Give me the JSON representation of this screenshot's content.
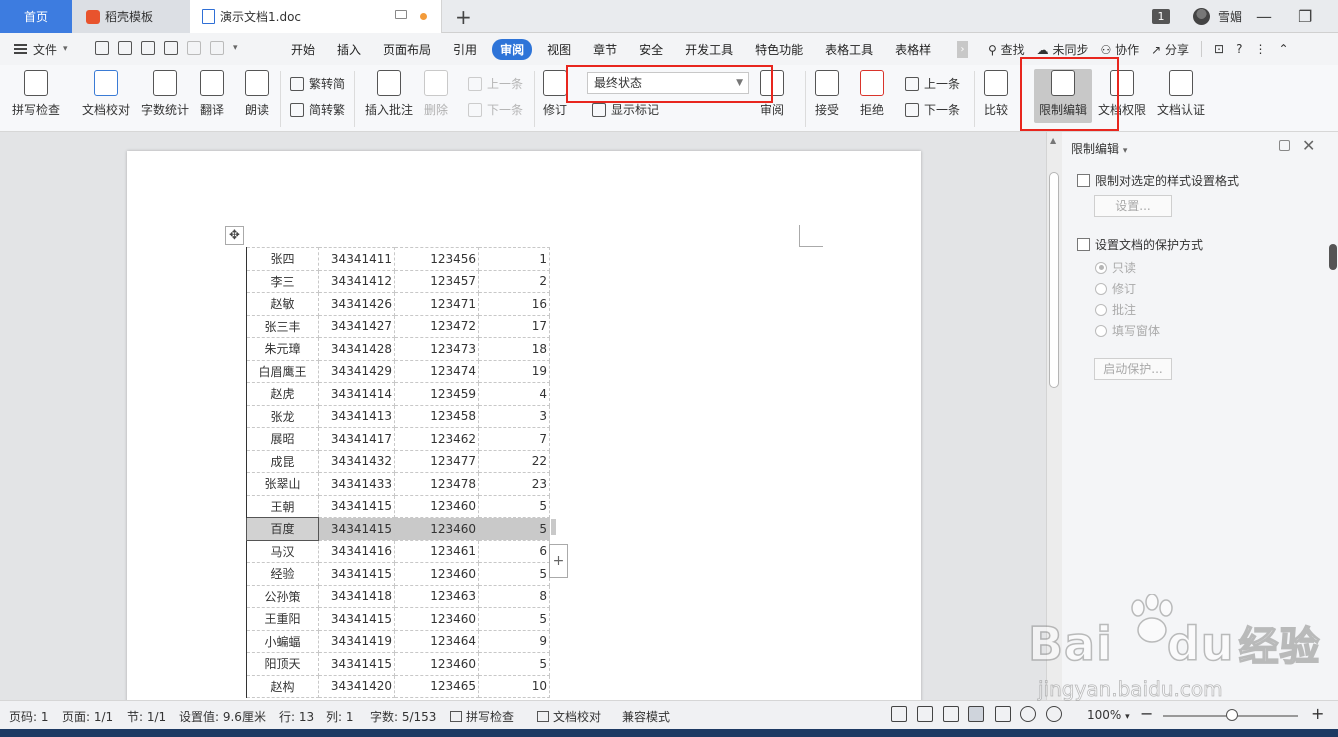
{
  "titlebar": {
    "tab_home": "首页",
    "tab_template": "稻壳模板",
    "tab_doc": "演示文档1.doc",
    "window_count": "1",
    "user_name": "雪媚"
  },
  "menubar": {
    "file": "文件",
    "items": [
      "开始",
      "插入",
      "页面布局",
      "引用",
      "审阅",
      "视图",
      "章节",
      "安全",
      "开发工具",
      "特色功能",
      "表格工具",
      "表格样"
    ],
    "active": "审阅",
    "search": "查找",
    "sync": "未同步",
    "collab": "协作",
    "share": "分享"
  },
  "ribbon": {
    "spell": "拼写检查",
    "proof": "文档校对",
    "wordcount": "字数统计",
    "translate": "翻译",
    "read": "朗读",
    "trad": "繁转简",
    "simp": "简转繁",
    "insert_comment": "插入批注",
    "delete": "删除",
    "prev_comment": "上一条",
    "next_comment": "下一条",
    "revise": "修订",
    "display_state": "最终状态",
    "show_marks": "显示标记",
    "review": "审阅",
    "accept": "接受",
    "reject": "拒绝",
    "prev": "上一条",
    "next": "下一条",
    "compare": "比较",
    "restrict_edit": "限制编辑",
    "doc_permission": "文档权限",
    "doc_cert": "文档认证"
  },
  "table": {
    "rows": [
      [
        "张四",
        "34341411",
        "123456",
        "1"
      ],
      [
        "李三",
        "34341412",
        "123457",
        "2"
      ],
      [
        "赵敏",
        "34341426",
        "123471",
        "16"
      ],
      [
        "张三丰",
        "34341427",
        "123472",
        "17"
      ],
      [
        "朱元璋",
        "34341428",
        "123473",
        "18"
      ],
      [
        "白眉鹰王",
        "34341429",
        "123474",
        "19"
      ],
      [
        "赵虎",
        "34341414",
        "123459",
        "4"
      ],
      [
        "张龙",
        "34341413",
        "123458",
        "3"
      ],
      [
        "展昭",
        "34341417",
        "123462",
        "7"
      ],
      [
        "成昆",
        "34341432",
        "123477",
        "22"
      ],
      [
        "张翠山",
        "34341433",
        "123478",
        "23"
      ],
      [
        "王朝",
        "34341415",
        "123460",
        "5"
      ],
      [
        "百度",
        "34341415",
        "123460",
        "5"
      ],
      [
        "马汉",
        "34341416",
        "123461",
        "6"
      ],
      [
        "经验",
        "34341415",
        "123460",
        "5"
      ],
      [
        "公孙策",
        "34341418",
        "123463",
        "8"
      ],
      [
        "王重阳",
        "34341415",
        "123460",
        "5"
      ],
      [
        "小蝙蝠",
        "34341419",
        "123464",
        "9"
      ],
      [
        "阳顶天",
        "34341415",
        "123460",
        "5"
      ],
      [
        "赵构",
        "34341420",
        "123465",
        "10"
      ]
    ],
    "selected_index": 12
  },
  "panel": {
    "title": "限制编辑",
    "opt1": "限制对选定的样式设置格式",
    "settings_btn": "设置...",
    "opt2": "设置文档的保护方式",
    "radios": [
      "只读",
      "修订",
      "批注",
      "填写窗体"
    ],
    "start_btn": "启动保护..."
  },
  "status": {
    "page_no": "页码: 1",
    "pages": "页面: 1/1",
    "section": "节: 1/1",
    "setting": "设置值: 9.6厘米",
    "row": "行: 13",
    "col": "列: 1",
    "words": "字数: 5/153",
    "spell": "拼写检查",
    "proof": "文档校对",
    "compat": "兼容模式",
    "zoom": "100%"
  },
  "watermark": {
    "brand": "Bai",
    "brand2": "du",
    "cn": "经验",
    "url": "jingyan.baidu.com"
  }
}
